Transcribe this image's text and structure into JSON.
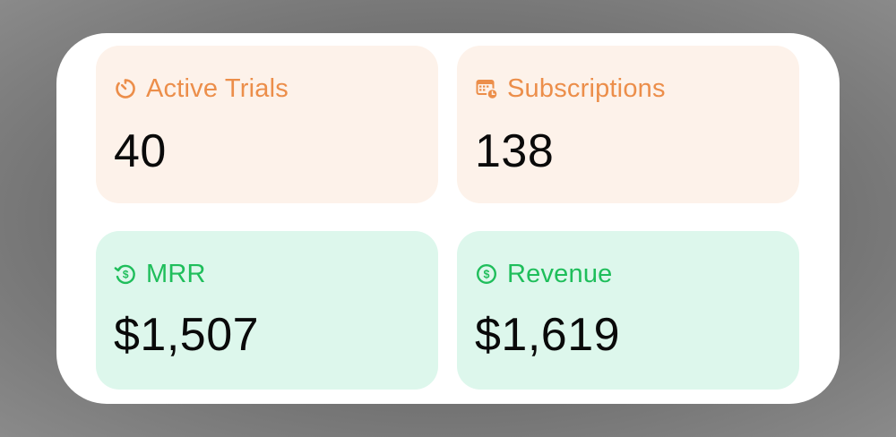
{
  "stats": [
    {
      "label": "Active Trials",
      "value": "40",
      "icon": "timer-icon",
      "color": "#ec8e4a"
    },
    {
      "label": "Subscriptions",
      "value": "138",
      "icon": "calendar-clock-icon",
      "color": "#ec8e4a"
    },
    {
      "label": "MRR",
      "value": "$1,507",
      "icon": "recurring-dollar-icon",
      "color": "#1fbe5b"
    },
    {
      "label": "Revenue",
      "value": "$1,619",
      "icon": "dollar-circle-icon",
      "color": "#1fbe5b"
    }
  ],
  "colors": {
    "orange_tile_bg": "#fdf2ea",
    "green_tile_bg": "#ddf7ec",
    "orange_accent": "#ec8e4a",
    "green_accent": "#1fbe5b"
  }
}
